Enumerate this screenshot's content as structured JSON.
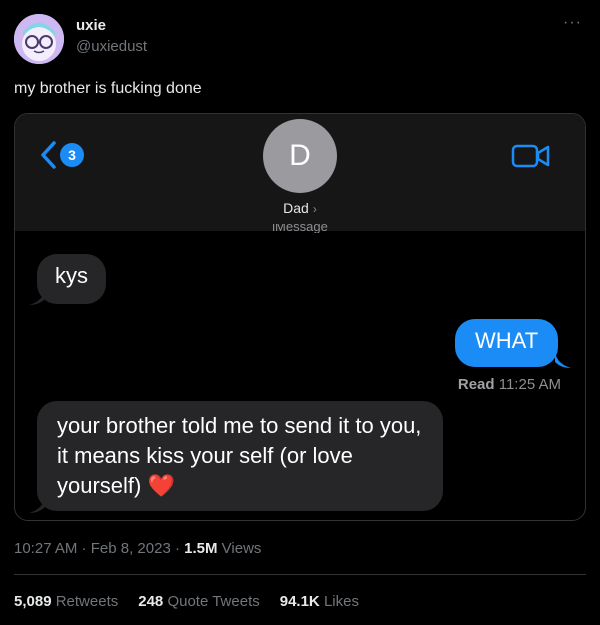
{
  "author": {
    "name": "uxie",
    "handle": "@uxiedust",
    "more_icon": "more-dots-icon"
  },
  "tweet": {
    "text": "my brother is fucking done"
  },
  "screenshot": {
    "back_count": "3",
    "contact_initial": "D",
    "contact_name": "Dad",
    "contact_chevron": "›",
    "service_label": "iMessage",
    "messages": [
      {
        "from": "them",
        "text": "kys"
      },
      {
        "from": "me",
        "text": "WHAT"
      },
      {
        "from": "them",
        "text": "your brother told me to send it to you, it means kiss your self (or love yourself)",
        "emoji": "❤️"
      }
    ],
    "read_label": "Read",
    "read_time": "11:25 AM",
    "colors": {
      "bubble_out": "#1b8cf5",
      "bubble_in": "#262628"
    }
  },
  "meta": {
    "time": "10:27 AM",
    "date": "Feb 8, 2023",
    "views_count": "1.5M",
    "views_label": "Views"
  },
  "stats": {
    "retweets_count": "5,089",
    "retweets_label": "Retweets",
    "quotes_count": "248",
    "quotes_label": "Quote Tweets",
    "likes_count": "94.1K",
    "likes_label": "Likes"
  }
}
